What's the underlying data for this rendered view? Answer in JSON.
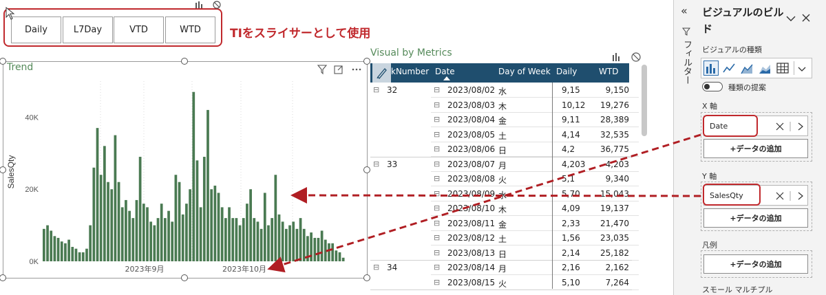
{
  "slicer": {
    "buttons": [
      "Daily",
      "L7Day",
      "VTD",
      "WTD"
    ],
    "annotation": "TIをスライサーとして使用"
  },
  "trend_chart": {
    "title": "Trend",
    "chart_data": {
      "type": "bar",
      "title": "Trend",
      "ylabel": "SalesQty",
      "xlabel": "",
      "ylim": [
        0,
        50000
      ],
      "y_ticks": [
        "0K",
        "20K",
        "40K"
      ],
      "x_tick_labels": [
        "2023年9月",
        "2023年10月"
      ],
      "bar_color": "#4a7a52",
      "values": [
        9000,
        10000,
        8500,
        7000,
        6500,
        5500,
        5000,
        6000,
        4000,
        3500,
        2500,
        2500,
        3500,
        10000,
        26000,
        37000,
        24000,
        32000,
        22000,
        20000,
        35000,
        22000,
        15000,
        17000,
        14000,
        12000,
        17000,
        29000,
        16000,
        15000,
        11000,
        10000,
        12000,
        16000,
        12000,
        14000,
        11000,
        24000,
        22000,
        13000,
        16000,
        20000,
        47000,
        28000,
        15000,
        29000,
        42000,
        20000,
        21000,
        19000,
        15000,
        12000,
        15000,
        12000,
        12000,
        10000,
        12000,
        16000,
        20000,
        12000,
        11000,
        9000,
        19000,
        10000,
        12000,
        24000,
        13000,
        11000,
        9000,
        10000,
        11000,
        9000,
        12000,
        9000,
        7000,
        8000,
        6500,
        6500,
        8500,
        6000,
        5000,
        5000,
        3000,
        2500,
        1000
      ]
    }
  },
  "table": {
    "title": "Visual by Metrics",
    "columns": [
      "kNumber",
      "Date",
      "Day of Week",
      "Daily",
      "WTD"
    ],
    "expand_glyph": "⊟",
    "groups": [
      {
        "week": "32",
        "rows": [
          {
            "date": "2023/08/02",
            "dow": "水",
            "daily": "9,15",
            "wtd": "9,150"
          },
          {
            "date": "2023/08/03",
            "dow": "木",
            "daily": "10,12",
            "wtd": "19,276"
          },
          {
            "date": "2023/08/04",
            "dow": "金",
            "daily": "9,11",
            "wtd": "28,389"
          },
          {
            "date": "2023/08/05",
            "dow": "土",
            "daily": "4,14",
            "wtd": "32,535"
          },
          {
            "date": "2023/08/06",
            "dow": "日",
            "daily": "4,2",
            "wtd": "36,775"
          }
        ]
      },
      {
        "week": "33",
        "rows": [
          {
            "date": "2023/08/07",
            "dow": "月",
            "daily": "4,203",
            "wtd": "4,203"
          },
          {
            "date": "2023/08/08",
            "dow": "火",
            "daily": "5,1",
            "wtd": "9,340"
          },
          {
            "date": "2023/08/09",
            "dow": "水",
            "daily": "5,70",
            "wtd": "15,043"
          },
          {
            "date": "2023/08/10",
            "dow": "木",
            "daily": "4,09",
            "wtd": "19,137"
          },
          {
            "date": "2023/08/11",
            "dow": "金",
            "daily": "2,33",
            "wtd": "21,470"
          },
          {
            "date": "2023/08/12",
            "dow": "土",
            "daily": "1,56",
            "wtd": "23,035"
          },
          {
            "date": "2023/08/13",
            "dow": "日",
            "daily": "2,14",
            "wtd": "25,182"
          }
        ]
      },
      {
        "week": "34",
        "rows": [
          {
            "date": "2023/08/14",
            "dow": "月",
            "daily": "2,16",
            "wtd": "2,162"
          },
          {
            "date": "2023/08/15",
            "dow": "火",
            "daily": "5,10",
            "wtd": "7,264"
          }
        ]
      }
    ]
  },
  "pane": {
    "collapse_icon": "«",
    "filter_label": "フィルター",
    "title": "ビジュアルのビルド",
    "visual_type_label": "ビジュアルの種類",
    "suggest_label": "種類の提案",
    "x_axis_label": "X 軸",
    "x_field": "Date",
    "y_axis_label": "Y 軸",
    "y_field": "SalesQty",
    "legend_label": "凡例",
    "add_data": "+データの追加",
    "small_multiples": "スモール マルチプル"
  }
}
